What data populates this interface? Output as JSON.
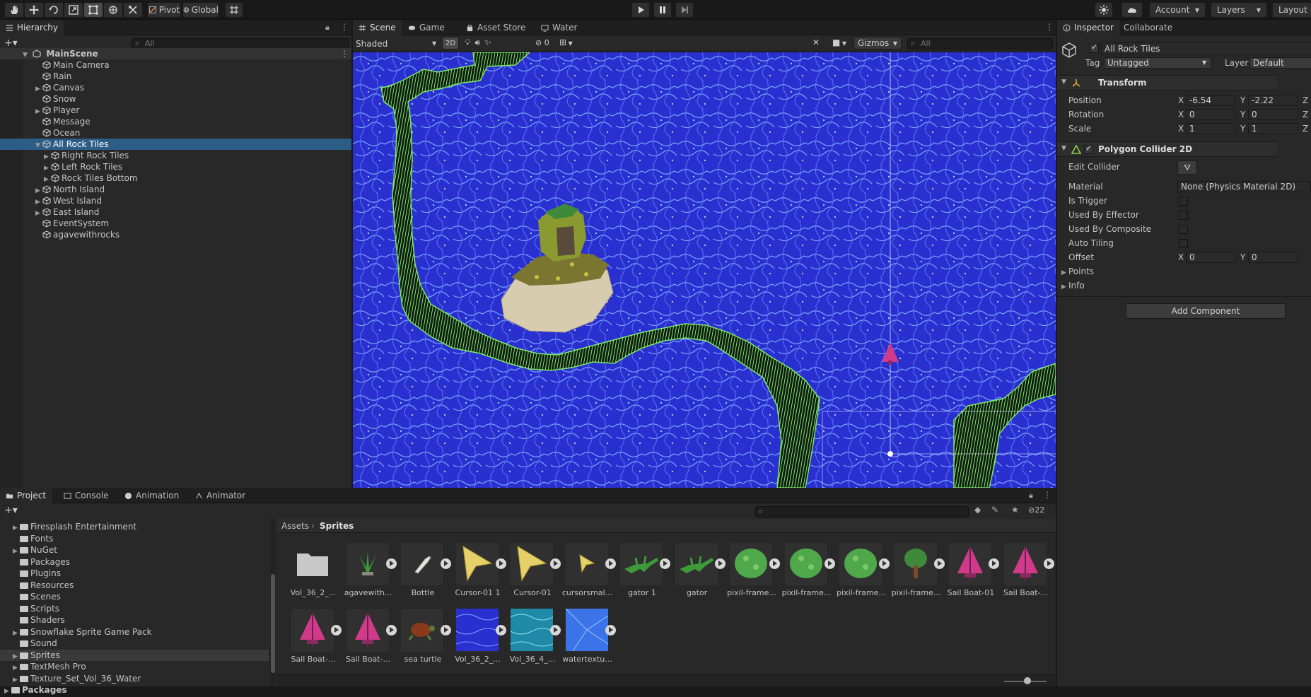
{
  "toolbar": {
    "pivot_label": "Pivot",
    "global_label": "Global",
    "account_label": "Account",
    "layers_label": "Layers",
    "layout_label": "Layout"
  },
  "hierarchy": {
    "tab_label": "Hierarchy",
    "search_placeholder": "All",
    "scene_name": "MainScene",
    "items": [
      {
        "label": "Main Camera"
      },
      {
        "label": "Rain"
      },
      {
        "label": "Canvas"
      },
      {
        "label": "Snow"
      },
      {
        "label": "Player"
      },
      {
        "label": "Message"
      },
      {
        "label": "Ocean"
      },
      {
        "label": "All Rock Tiles"
      },
      {
        "label": "Right Rock Tiles"
      },
      {
        "label": "Left Rock Tiles"
      },
      {
        "label": "Rock Tiles Bottom"
      },
      {
        "label": "North Island"
      },
      {
        "label": "West Island"
      },
      {
        "label": "East Island"
      },
      {
        "label": "EventSystem"
      },
      {
        "label": "agavewithrocks"
      }
    ]
  },
  "scene": {
    "tabs": [
      "Scene",
      "Game",
      "Asset Store",
      "Water"
    ],
    "shading_mode": "Shaded",
    "mode_2d": "2D",
    "hidden_count": "0",
    "gizmos_label": "Gizmos",
    "search_placeholder": "All"
  },
  "inspector": {
    "tabs": [
      "Inspector",
      "Collaborate"
    ],
    "object_name": "All Rock Tiles",
    "tag_label": "Tag",
    "tag_value": "Untagged",
    "layer_label": "Layer",
    "layer_value": "Default",
    "transform": {
      "title": "Transform",
      "position_label": "Position",
      "rotation_label": "Rotation",
      "scale_label": "Scale",
      "position": {
        "x": "-6.54",
        "y": "-2.22"
      },
      "rotation": {
        "x": "0",
        "y": "0"
      },
      "scale": {
        "x": "1",
        "y": "1"
      }
    },
    "collider": {
      "title": "Polygon Collider 2D",
      "edit_collider_label": "Edit Collider",
      "material_label": "Material",
      "material_value": "None (Physics Material 2D)",
      "is_trigger_label": "Is Trigger",
      "used_by_effector_label": "Used By Effector",
      "used_by_composite_label": "Used By Composite",
      "auto_tiling_label": "Auto Tiling",
      "offset_label": "Offset",
      "offset": {
        "x": "0",
        "y": "0"
      },
      "points_label": "Points",
      "info_label": "Info"
    },
    "add_component_label": "Add Component"
  },
  "project": {
    "tabs": [
      "Project",
      "Console",
      "Animation",
      "Animator"
    ],
    "hidden_count": "22",
    "breadcrumb": {
      "root": "Assets",
      "current": "Sprites"
    },
    "folders": [
      {
        "label": "Firesplash Entertainment"
      },
      {
        "label": "Fonts"
      },
      {
        "label": "NuGet"
      },
      {
        "label": "Packages"
      },
      {
        "label": "Plugins"
      },
      {
        "label": "Resources"
      },
      {
        "label": "Scenes"
      },
      {
        "label": "Scripts"
      },
      {
        "label": "Shaders"
      },
      {
        "label": "Snowflake Sprite Game Pack"
      },
      {
        "label": "Sound"
      },
      {
        "label": "Sprites"
      },
      {
        "label": "TextMesh Pro"
      },
      {
        "label": "Texture_Set_Vol_36_Water"
      },
      {
        "label": "Packages"
      }
    ],
    "assets": [
      {
        "label": "Vol_36_2_...",
        "icon": "folder-icon"
      },
      {
        "label": "agavewith...",
        "icon": "agave-sprite"
      },
      {
        "label": "Bottle",
        "icon": "bottle-sprite"
      },
      {
        "label": "Cursor-01 1",
        "icon": "cursor-sprite"
      },
      {
        "label": "Cursor-01",
        "icon": "cursor-sprite"
      },
      {
        "label": "cursorsmal...",
        "icon": "cursor-small-sprite"
      },
      {
        "label": "gator 1",
        "icon": "gator-sprite"
      },
      {
        "label": "gator",
        "icon": "gator-sprite"
      },
      {
        "label": "pixil-frame...",
        "icon": "bush-sprite"
      },
      {
        "label": "pixil-frame...",
        "icon": "bush-sprite"
      },
      {
        "label": "pixil-frame...",
        "icon": "bush-sprite"
      },
      {
        "label": "pixil-frame...",
        "icon": "tree-sprite"
      },
      {
        "label": "Sail Boat-01",
        "icon": "sailboat-sprite"
      },
      {
        "label": "Sail Boat-...",
        "icon": "sailboat-sprite"
      },
      {
        "label": "Sail Boat-...",
        "icon": "sailboat-sprite"
      },
      {
        "label": "Sail Boat-...",
        "icon": "sailboat-sprite"
      },
      {
        "label": "sea turtle",
        "icon": "turtle-sprite"
      },
      {
        "label": "Vol_36_2_...",
        "icon": "water-texture-blue"
      },
      {
        "label": "Vol_36_4_...",
        "icon": "water-texture-teal"
      },
      {
        "label": "watertextu...",
        "icon": "water-texture-light"
      }
    ]
  },
  "colors": {
    "selection": "#2c5d87",
    "water": "#2a36d8",
    "rock_outline": "#7de86a",
    "boat": "#d13a8a"
  }
}
